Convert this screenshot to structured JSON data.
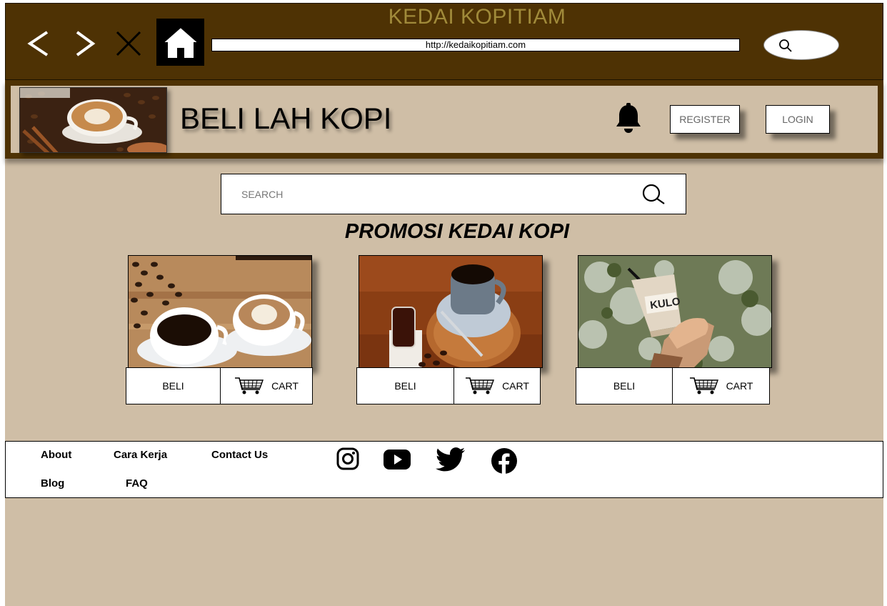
{
  "browser": {
    "title": "KEDAI KOPITIAM",
    "url": "http://kedaikopitiam.com"
  },
  "header": {
    "brand": "BELI LAH KOPI",
    "register_label": "REGISTER",
    "login_label": "LOGIN"
  },
  "search": {
    "placeholder": "SEARCH"
  },
  "promo": {
    "title": "PROMOSI KEDAI KOPI",
    "products": [
      {
        "image": "two-coffee-cups-photo",
        "buy_label": "BELI",
        "cart_label": "CART"
      },
      {
        "image": "coffee-on-wood-photo",
        "buy_label": "BELI",
        "cart_label": "CART"
      },
      {
        "image": "kulo-iced-coffee-photo",
        "buy_label": "BELI",
        "cart_label": "CART"
      }
    ]
  },
  "footer": {
    "links": [
      "About",
      "Cara Kerja",
      "Contact Us",
      "Blog",
      "FAQ"
    ],
    "social": [
      "instagram-icon",
      "youtube-icon",
      "twitter-icon",
      "facebook-icon"
    ]
  },
  "colors": {
    "dark_brown": "#4e3204",
    "tan": "#cfbea6",
    "title_gold": "#a08a3a"
  }
}
